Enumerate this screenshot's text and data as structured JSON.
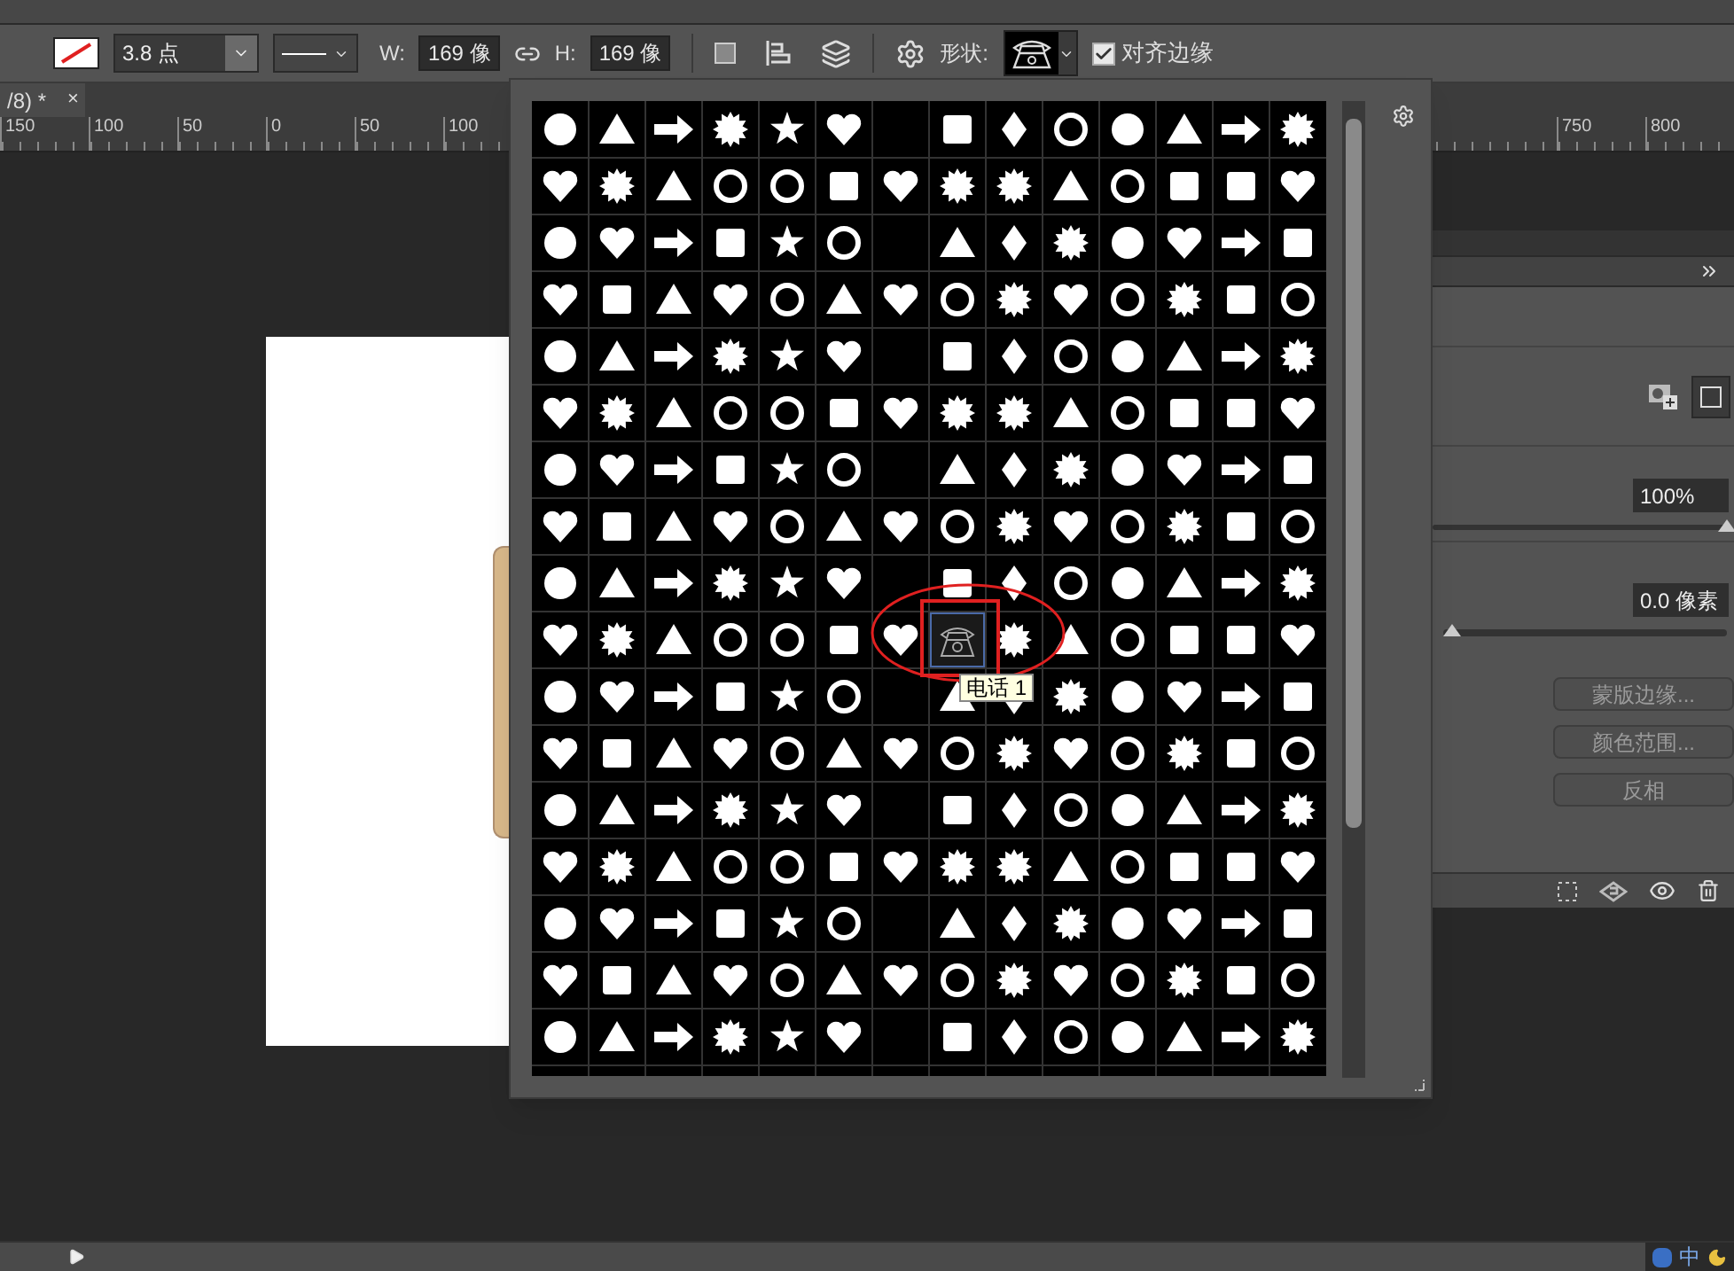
{
  "options_bar": {
    "stroke_width": "3.8 点",
    "width_label": "W:",
    "width_value": "169 像",
    "height_label": "H:",
    "height_value": "169 像",
    "shape_label": "形状:",
    "align_edges": {
      "label": "对齐边缘",
      "checked": true
    }
  },
  "document_tab": {
    "title": "/8) *",
    "close": "×"
  },
  "ruler": {
    "labels": [
      "150",
      "100",
      "50",
      "0",
      "50",
      "100"
    ],
    "right_labels": [
      "750",
      "800"
    ]
  },
  "shape_picker": {
    "tooltip": "电话 1"
  },
  "masks_panel": {
    "density": {
      "value": "100%",
      "level": 1
    },
    "feather": {
      "value": "0.0 像素",
      "level": 0
    },
    "buttons": [
      "蒙版边缘...",
      "颜色范围...",
      "反相"
    ]
  },
  "status_bar": {
    "ime": "中"
  }
}
